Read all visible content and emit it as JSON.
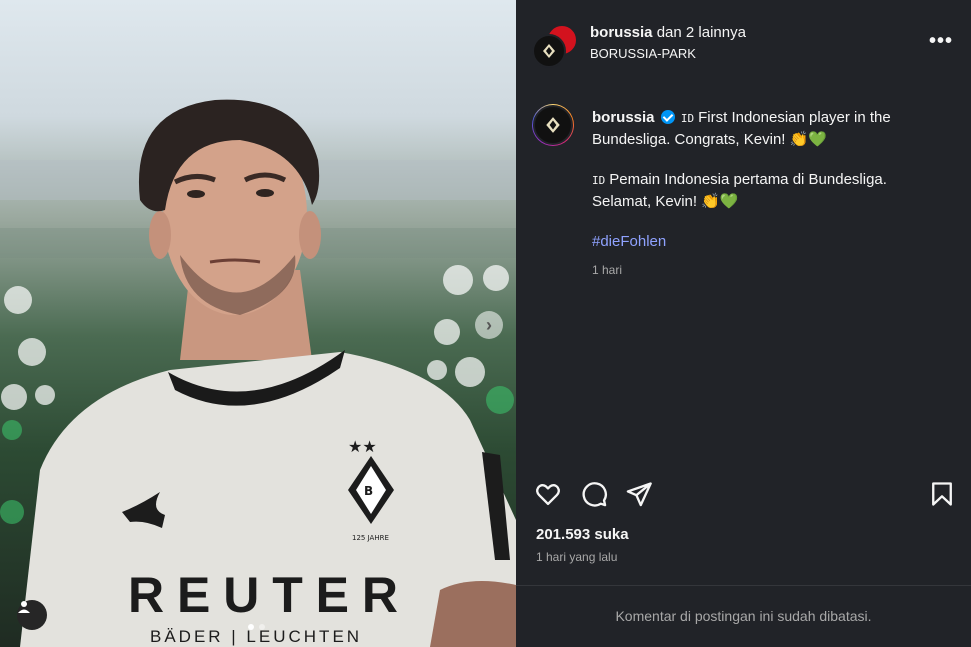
{
  "post": {
    "header": {
      "username": "borussia",
      "coauthors_text": "dan 2 lainnya",
      "location": "BORUSSIA-PARK",
      "more_icon": "more-horizontal-icon"
    },
    "caption": {
      "username": "borussia",
      "verified_icon": "verified-badge-icon",
      "line1_flag": "ID",
      "line1_text": "First Indonesian player in the Bundesliga. Congrats, Kevin! 👏💚",
      "line2_flag": "ID",
      "line2_text": "Pemain Indonesia pertama di Bundesliga. Selamat, Kevin! 👏💚",
      "hashtag": "#dieFohlen",
      "time": "1 hari"
    },
    "actions": {
      "like_icon": "heart-icon",
      "comment_icon": "comment-icon",
      "share_icon": "share-icon",
      "save_icon": "bookmark-icon"
    },
    "likes_text": "201.593 suka",
    "posted_ago": "1 hari yang lalu",
    "comments_limited": "Komentar di postingan ini sudah dibatasi.",
    "media": {
      "jersey_sponsor": "REUTER",
      "jersey_sub": "BÄDER | LEUCHTEN",
      "jersey_badge_text": "125 JAHRE",
      "carousel_count": 2,
      "carousel_index": 1
    }
  }
}
